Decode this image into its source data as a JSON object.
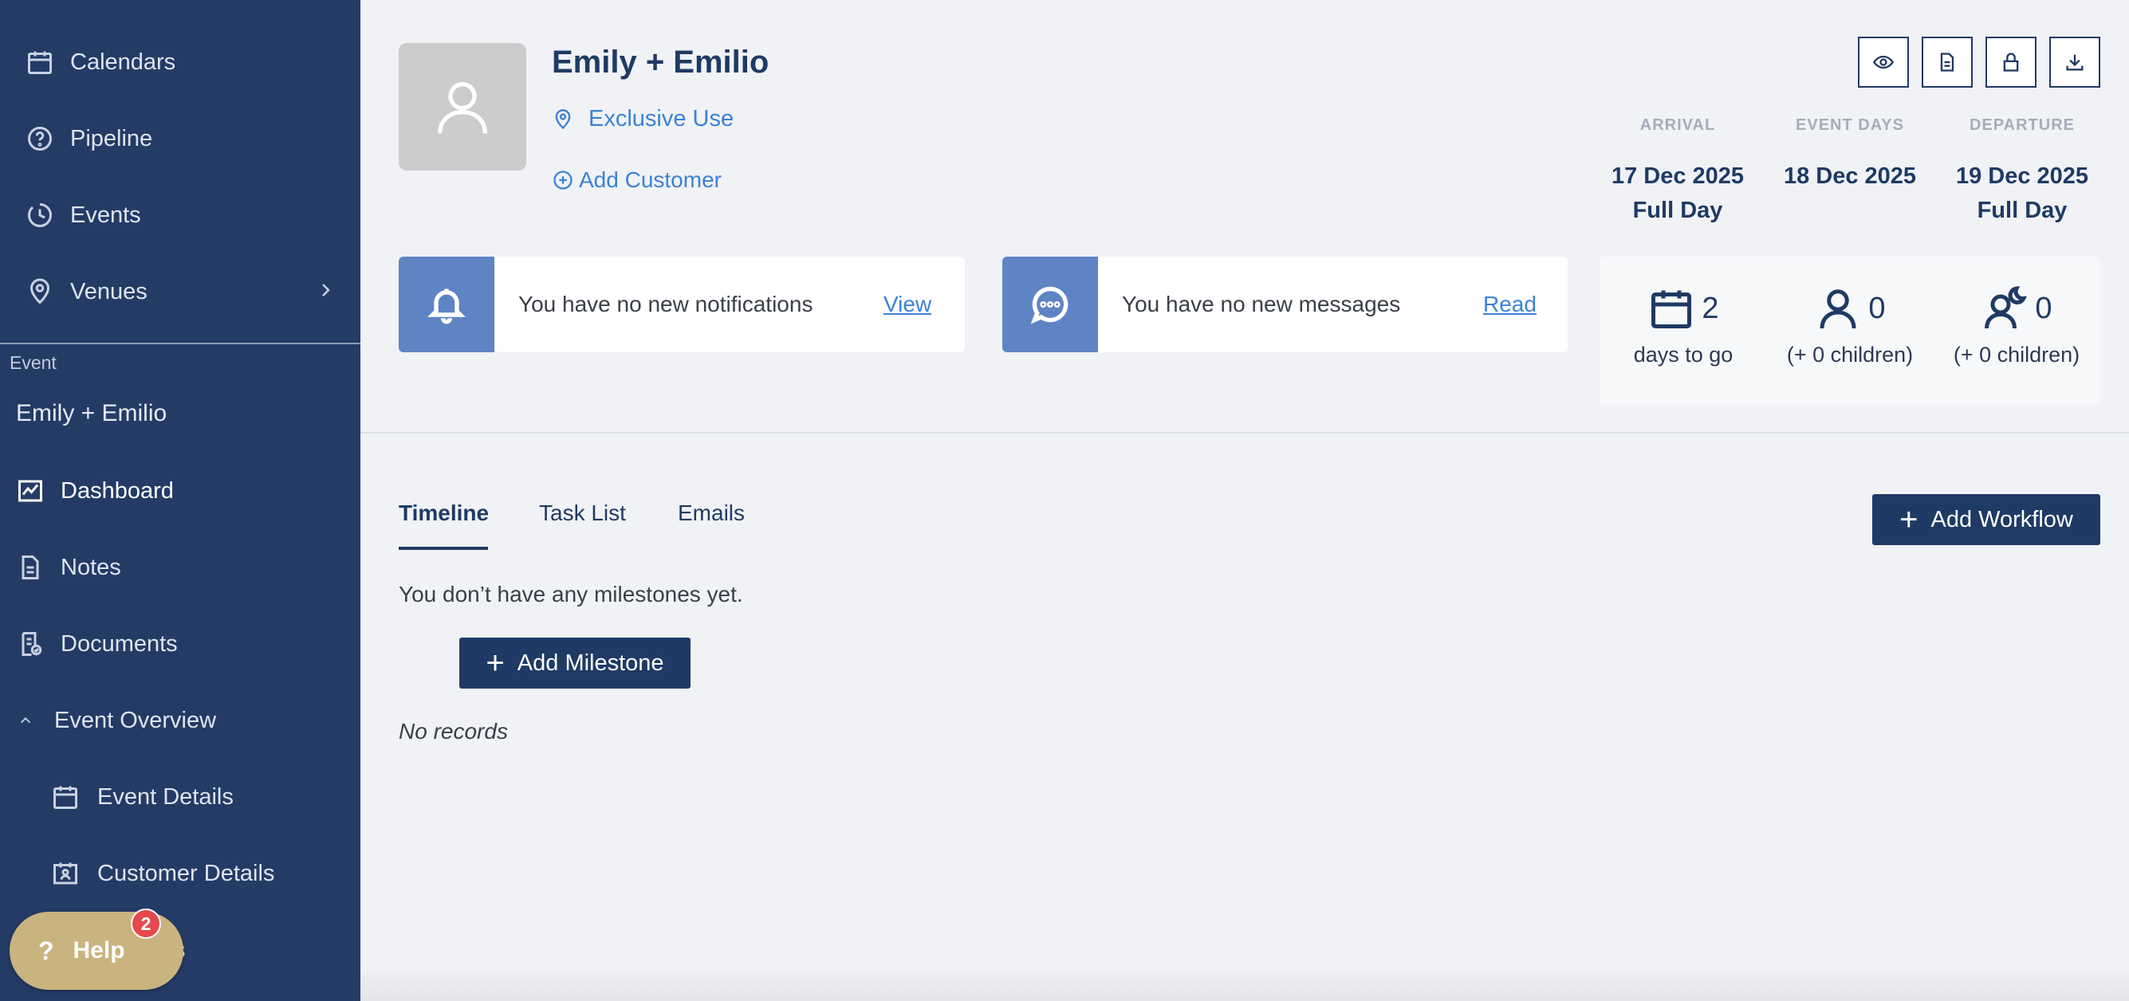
{
  "sidebar": {
    "items": [
      {
        "label": "Calendars",
        "icon": "calendar-icon"
      },
      {
        "label": "Pipeline",
        "icon": "question-circle-icon"
      },
      {
        "label": "Events",
        "icon": "clock-history-icon"
      },
      {
        "label": "Venues",
        "icon": "map-pin-icon"
      }
    ],
    "section_label": "Event",
    "event_name": "Emily + Emilio",
    "event_items": [
      {
        "label": "Dashboard",
        "icon": "chart-line-icon"
      },
      {
        "label": "Notes",
        "icon": "document-icon"
      },
      {
        "label": "Documents",
        "icon": "document-check-icon"
      },
      {
        "label": "Event Overview",
        "icon": "chevron-up-icon"
      },
      {
        "label": "Event Details",
        "icon": "calendar-icon"
      },
      {
        "label": "Customer Details",
        "icon": "contact-card-icon"
      },
      {
        "label": "s",
        "icon": ""
      }
    ]
  },
  "help": {
    "label": "Help",
    "badge": "2"
  },
  "header": {
    "title": "Emily + Emilio",
    "venue": "Exclusive Use",
    "add_customer": "Add Customer",
    "dates": [
      {
        "header": "ARRIVAL",
        "date": "17 Dec 2025",
        "sub": "Full Day"
      },
      {
        "header": "EVENT DAYS",
        "date": "18 Dec 2025",
        "sub": ""
      },
      {
        "header": "DEPARTURE",
        "date": "19 Dec 2025",
        "sub": "Full Day"
      }
    ]
  },
  "notifications": {
    "text": "You have no new notifications",
    "link": "View"
  },
  "messages": {
    "text": "You have no new messages",
    "link": "Read"
  },
  "stats": [
    {
      "value": "2",
      "label": "days to go"
    },
    {
      "value": "0",
      "label": "(+ 0 children)"
    },
    {
      "value": "0",
      "label": "(+ 0 children)"
    }
  ],
  "tabs": [
    {
      "label": "Timeline"
    },
    {
      "label": "Task List"
    },
    {
      "label": "Emails"
    }
  ],
  "add_workflow": "Add Workflow",
  "empty_message": "You don’t have any milestones yet.",
  "add_milestone": "Add Milestone",
  "no_records": "No records",
  "colors": {
    "sidebar": "#243b66",
    "primary": "#1f3a64",
    "link": "#3b82d6",
    "card_accent": "#5f84c4",
    "help": "#c9b37e",
    "badge": "#e5484d"
  }
}
